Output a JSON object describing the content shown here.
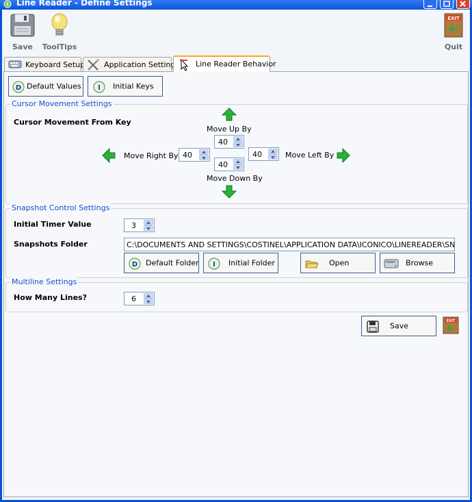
{
  "window": {
    "title": "Line Reader - Define Settings"
  },
  "toolbar": {
    "save_label": "Save",
    "tooltips_label": "ToolTips",
    "quit_label": "Quit"
  },
  "tabs": [
    {
      "label": "Keyboard Setup"
    },
    {
      "label": "Application Settings"
    },
    {
      "label": "Line Reader Behavior"
    }
  ],
  "top_buttons": {
    "default_values": "Default Values",
    "initial_keys": "Initial Keys"
  },
  "cursor": {
    "legend": "Cursor Movement Settings",
    "heading": "Cursor Movement From Key",
    "move_up_label": "Move Up By",
    "move_down_label": "Move Down By",
    "move_right_label": "Move Right By",
    "move_left_label": "Move Left By",
    "up_value": "40",
    "down_value": "40",
    "right_value": "40",
    "left_value": "40"
  },
  "snapshot": {
    "legend": "Snapshot Control Settings",
    "timer_label": "Initial Timer Value",
    "timer_value": "3",
    "folder_label": "Snapshots Folder",
    "folder_value": "C:\\DOCUMENTS AND SETTINGS\\COSTINEL\\APPLICATION DATA\\ICONICO\\LINEREADER\\SN",
    "default_folder": "Default Folder",
    "initial_folder": "Initial Folder",
    "open": "Open",
    "browse": "Browse"
  },
  "multiline": {
    "legend": "Multiline Settings",
    "lines_label": "How Many Lines?",
    "lines_value": "6"
  },
  "footer": {
    "save_label": "Save"
  },
  "colors": {
    "titlebar": "#0b55d8",
    "legend_text": "#1a4fcf",
    "arrow_green": "#27b33a",
    "button_border": "#3d5a8a"
  }
}
